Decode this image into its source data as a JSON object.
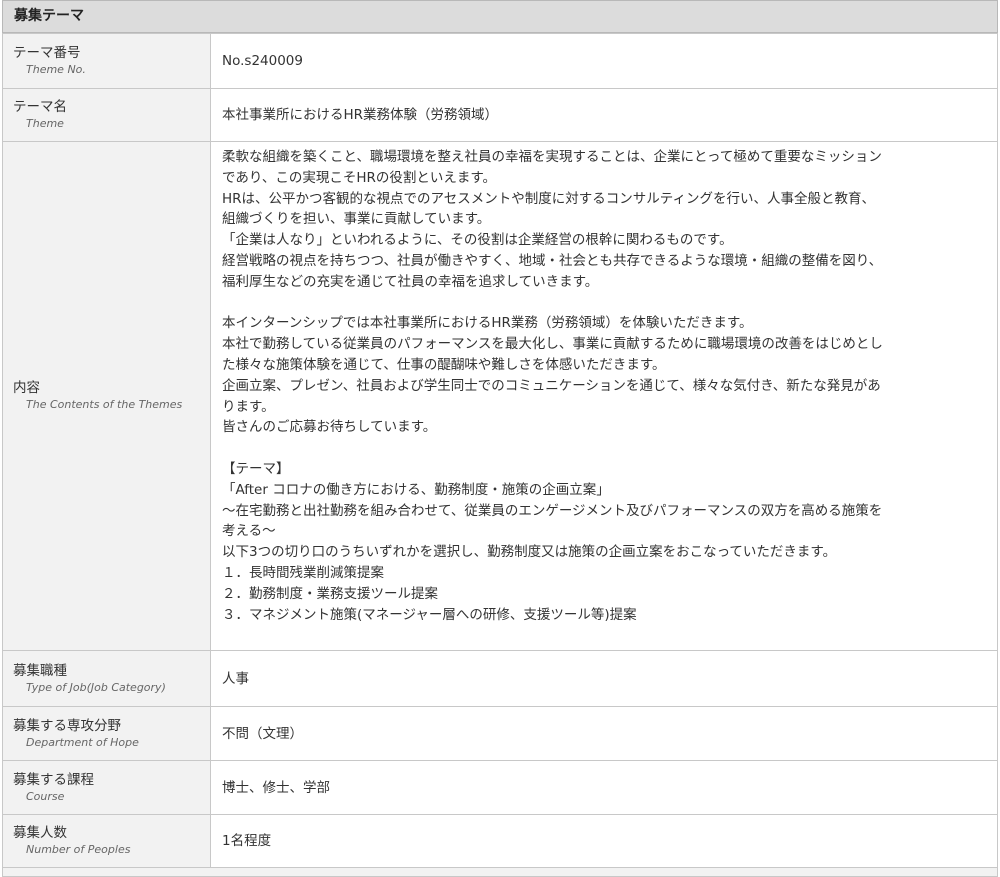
{
  "section": {
    "title": "募集テーマ"
  },
  "rows": {
    "theme_no": {
      "label_ja": "テーマ番号",
      "label_en": "Theme No.",
      "value": "No.s240009"
    },
    "theme": {
      "label_ja": "テーマ名",
      "label_en": "Theme",
      "value": "本社事業所におけるHR業務体験（労務領域）"
    },
    "contents": {
      "label_ja": "内容",
      "label_en": "The Contents of the Themes",
      "paragraphs": [
        "柔軟な組織を築くこと、職場環境を整え社員の幸福を実現することは、企業にとって極めて重要なミッション\nであり、この実現こそHRの役割といえます。\nHRは、公平かつ客観的な視点でのアセスメントや制度に対するコンサルティングを行い、人事全般と教育、\n組織づくりを担い、事業に貢献しています。\n「企業は人なり」といわれるように、その役割は企業経営の根幹に関わるものです。\n経営戦略の視点を持ちつつ、社員が働きやすく、地域・社会とも共存できるような環境・組織の整備を図り、\n福利厚生などの充実を通じて社員の幸福を追求していきます。",
        "本インターンシップでは本社事業所におけるHR業務（労務領域）を体験いただきます。\n本社で勤務している従業員のパフォーマンスを最大化し、事業に貢献するために職場環境の改善をはじめとし\nた様々な施策体験を通じて、仕事の醍醐味や難しさを体感いただきます。\n企画立案、プレゼン、社員および学生同士でのコミュニケーションを通じて、様々な気付き、新たな発見があ\nります。\n皆さんのご応募お待ちしています。",
        "【テーマ】\n「After コロナの働き方における、勤務制度・施策の企画立案」\n～在宅勤務と出社勤務を組み合わせて、従業員のエンゲージメント及びパフォーマンスの双方を高める施策を\n考える～\n以下3つの切り口のうちいずれかを選択し、勤務制度又は施策の企画立案をおこなっていただきます。\n１．長時間残業削減策提案\n２．勤務制度・業務支援ツール提案\n３．マネジメント施策(マネージャー層への研修、支援ツール等)提案"
      ]
    },
    "job_category": {
      "label_ja": "募集職種",
      "label_en": "Type of Job(Job Category)",
      "value": "人事"
    },
    "department": {
      "label_ja": "募集する専攻分野",
      "label_en": "Department of Hope",
      "value": "不問（文理）"
    },
    "course": {
      "label_ja": "募集する課程",
      "label_en": "Course",
      "value": "博士、修士、学部"
    },
    "people": {
      "label_ja": "募集人数",
      "label_en": "Number of Peoples",
      "value": "1名程度"
    }
  }
}
